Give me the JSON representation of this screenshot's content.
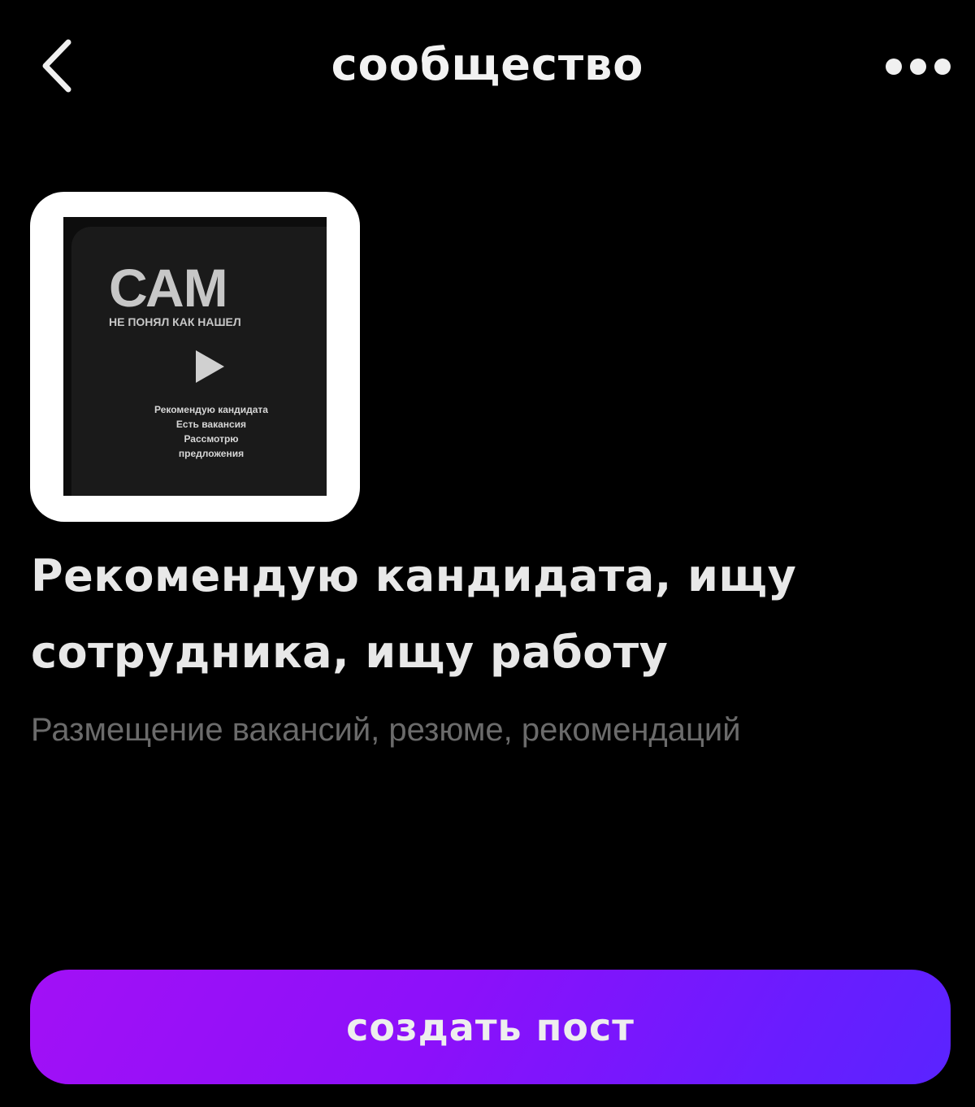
{
  "header": {
    "title": "сообщество",
    "back_icon": "chevron-left-icon",
    "more_icon": "more-dots-icon"
  },
  "community": {
    "avatar": {
      "title": "САМ",
      "subtitle": "НЕ ПОНЯЛ КАК НАШЕЛ",
      "lines": [
        "Рекомендую кандидата",
        "Есть вакансия",
        "Рассмотрю",
        "предложения"
      ]
    },
    "name": "Рекомендую кандидата, ищу сотрудника, ищу работу",
    "description": "Размещение вакансий, резюме, рекомендаций"
  },
  "actions": {
    "create_post_label": "создать пост"
  },
  "colors": {
    "background": "#000000",
    "button_gradient_start": "#a210f6",
    "button_gradient_end": "#5a24ff",
    "description_text": "#6b6b6b"
  }
}
